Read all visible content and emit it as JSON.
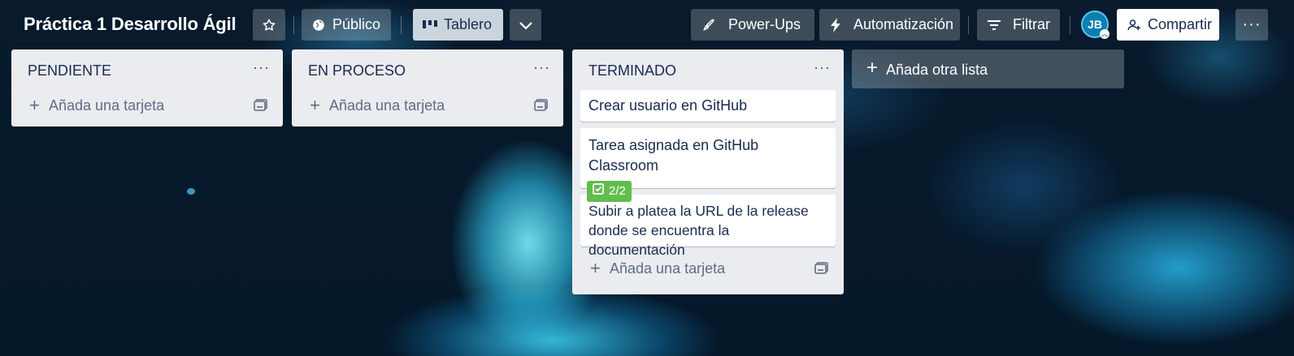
{
  "board": {
    "title": "Práctica 1 Desarrollo Ágil",
    "visibility_label": "Público",
    "view_label": "Tablero",
    "powerups_label": "Power-Ups",
    "automation_label": "Automatización",
    "filter_label": "Filtrar",
    "share_label": "Compartir",
    "avatar_initials": "JB"
  },
  "lists": [
    {
      "title": "PENDIENTE",
      "add_card_label": "Añada una tarjeta",
      "cards": []
    },
    {
      "title": "EN PROCESO",
      "add_card_label": "Añada una tarjeta",
      "cards": []
    },
    {
      "title": "TERMINADO",
      "add_card_label": "Añada una tarjeta",
      "cards": [
        {
          "title": "Crear usuario en GitHub"
        },
        {
          "title": "Tarea asignada en GitHub Classroom",
          "checklist": "2/2"
        },
        {
          "title": "Subir a platea la URL de la release donde se encuentra la documentación"
        }
      ]
    }
  ],
  "add_list_label": "Añada otra lista",
  "list_menu_glyph": "···",
  "colors": {
    "list_bg": "#ebecf0",
    "checklist_badge": "#61bd4f",
    "text": "#172b4d"
  }
}
